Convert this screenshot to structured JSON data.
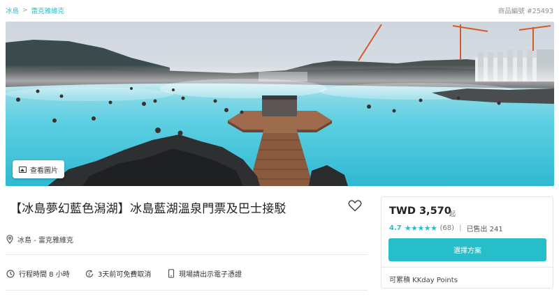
{
  "breadcrumb": {
    "items": [
      "冰島",
      "雷克雅維克"
    ],
    "separator": ">"
  },
  "product_id": "商品編號 #25493",
  "hero": {
    "view_photos_label": "查看圖片"
  },
  "product": {
    "title": "【冰島夢幻藍色潟湖】冰島藍湖溫泉門票及巴士接駁",
    "location": "冰島 - 雷克雅維克",
    "features": [
      {
        "icon": "clock-icon",
        "label": "行程時間 8 小時"
      },
      {
        "icon": "refund-icon",
        "label": "3天前可免費取消"
      },
      {
        "icon": "phone-icon",
        "label": "現場請出示電子憑證"
      }
    ]
  },
  "booking": {
    "price": "TWD 3,570",
    "price_suffix": "起",
    "rating": "4.7",
    "stars": "★★★★★",
    "review_count": "(68)",
    "divider": "|",
    "sold": "已售出 241",
    "cta_label": "選擇方案",
    "points_label": "可累積 KKday Points"
  },
  "colors": {
    "accent": "#26bec9",
    "lagoon": "#55cde0"
  }
}
